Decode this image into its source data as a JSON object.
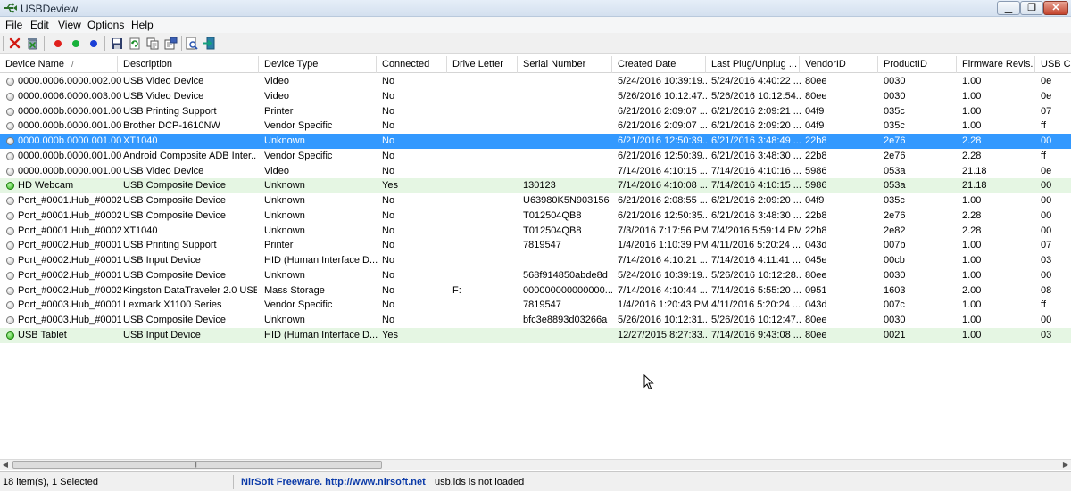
{
  "window": {
    "title": "USBDeview"
  },
  "menu": [
    "File",
    "Edit",
    "View",
    "Options",
    "Help"
  ],
  "toolbar": {
    "icons": [
      "disconnect-icon",
      "uninstall-icon",
      "red-dot-icon",
      "green-dot-icon",
      "blue-dot-icon",
      "save-icon",
      "refresh-icon",
      "copy-icon",
      "properties-icon",
      "report-icon",
      "exit-icon"
    ],
    "colors": {
      "red": "#e0201c",
      "green": "#17b13a",
      "blue": "#1b3fd6"
    }
  },
  "columns": [
    "Device Name",
    "Description",
    "Device Type",
    "Connected",
    "Drive Letter",
    "Serial Number",
    "Created Date",
    "Last Plug/Unplug ...",
    "VendorID",
    "ProductID",
    "Firmware Revis...",
    "USB Cla"
  ],
  "sort_indicator": "/",
  "rows": [
    {
      "connected_state": "off",
      "highlight": "none",
      "cells": [
        "0000.0006.0000.002.00...",
        "USB Video Device",
        "Video",
        "No",
        "",
        "",
        "5/24/2016 10:39:19...",
        "5/24/2016 4:40:22 ...",
        "80ee",
        "0030",
        "1.00",
        "0e"
      ]
    },
    {
      "connected_state": "off",
      "highlight": "none",
      "cells": [
        "0000.0006.0000.003.00...",
        "USB Video Device",
        "Video",
        "No",
        "",
        "",
        "5/26/2016 10:12:47...",
        "5/26/2016 10:12:54...",
        "80ee",
        "0030",
        "1.00",
        "0e"
      ]
    },
    {
      "connected_state": "off",
      "highlight": "none",
      "cells": [
        "0000.000b.0000.001.00...",
        "USB Printing Support",
        "Printer",
        "No",
        "",
        "",
        "6/21/2016 2:09:07 ...",
        "6/21/2016 2:09:21 ...",
        "04f9",
        "035c",
        "1.00",
        "07"
      ]
    },
    {
      "connected_state": "off",
      "highlight": "none",
      "cells": [
        "0000.000b.0000.001.00...",
        "Brother DCP-1610NW",
        "Vendor Specific",
        "No",
        "",
        "",
        "6/21/2016 2:09:07 ...",
        "6/21/2016 2:09:20 ...",
        "04f9",
        "035c",
        "1.00",
        "ff"
      ]
    },
    {
      "connected_state": "off",
      "highlight": "selected",
      "cells": [
        "0000.000b.0000.001.00...",
        "XT1040",
        "Unknown",
        "No",
        "",
        "",
        "6/21/2016 12:50:39...",
        "6/21/2016 3:48:49 ...",
        "22b8",
        "2e76",
        "2.28",
        "00"
      ]
    },
    {
      "connected_state": "off",
      "highlight": "none",
      "cells": [
        "0000.000b.0000.001.00...",
        "Android Composite ADB Inter...",
        "Vendor Specific",
        "No",
        "",
        "",
        "6/21/2016 12:50:39...",
        "6/21/2016 3:48:30 ...",
        "22b8",
        "2e76",
        "2.28",
        "ff"
      ]
    },
    {
      "connected_state": "off",
      "highlight": "none",
      "cells": [
        "0000.000b.0000.001.00...",
        "USB Video Device",
        "Video",
        "No",
        "",
        "",
        "7/14/2016 4:10:15 ...",
        "7/14/2016 4:10:16 ...",
        "5986",
        "053a",
        "21.18",
        "0e"
      ]
    },
    {
      "connected_state": "on",
      "highlight": "green",
      "cells": [
        "HD Webcam",
        "USB Composite Device",
        "Unknown",
        "Yes",
        "",
        "130123",
        "7/14/2016 4:10:08 ...",
        "7/14/2016 4:10:15 ...",
        "5986",
        "053a",
        "21.18",
        "00"
      ]
    },
    {
      "connected_state": "off",
      "highlight": "none",
      "cells": [
        "Port_#0001.Hub_#0002",
        "USB Composite Device",
        "Unknown",
        "No",
        "",
        "U63980K5N903156",
        "6/21/2016 2:08:55 ...",
        "6/21/2016 2:09:20 ...",
        "04f9",
        "035c",
        "1.00",
        "00"
      ]
    },
    {
      "connected_state": "off",
      "highlight": "none",
      "cells": [
        "Port_#0001.Hub_#0002",
        "USB Composite Device",
        "Unknown",
        "No",
        "",
        "T012504QB8",
        "6/21/2016 12:50:35...",
        "6/21/2016 3:48:30 ...",
        "22b8",
        "2e76",
        "2.28",
        "00"
      ]
    },
    {
      "connected_state": "off",
      "highlight": "none",
      "cells": [
        "Port_#0001.Hub_#0002",
        "XT1040",
        "Unknown",
        "No",
        "",
        "T012504QB8",
        "7/3/2016 7:17:56 PM",
        "7/4/2016 5:59:14 PM",
        "22b8",
        "2e82",
        "2.28",
        "00"
      ]
    },
    {
      "connected_state": "off",
      "highlight": "none",
      "cells": [
        "Port_#0002.Hub_#0001",
        "USB Printing Support",
        "Printer",
        "No",
        "",
        "7819547",
        "1/4/2016 1:10:39 PM",
        "4/11/2016 5:20:24 ...",
        "043d",
        "007b",
        "1.00",
        "07"
      ]
    },
    {
      "connected_state": "off",
      "highlight": "none",
      "cells": [
        "Port_#0002.Hub_#0001",
        "USB Input Device",
        "HID (Human Interface D...",
        "No",
        "",
        "",
        "7/14/2016 4:10:21 ...",
        "7/14/2016 4:11:41 ...",
        "045e",
        "00cb",
        "1.00",
        "03"
      ]
    },
    {
      "connected_state": "off",
      "highlight": "none",
      "cells": [
        "Port_#0002.Hub_#0001",
        "USB Composite Device",
        "Unknown",
        "No",
        "",
        "568f914850abde8d",
        "5/24/2016 10:39:19...",
        "5/26/2016 10:12:28...",
        "80ee",
        "0030",
        "1.00",
        "00"
      ]
    },
    {
      "connected_state": "off",
      "highlight": "none",
      "cells": [
        "Port_#0002.Hub_#0002",
        "Kingston DataTraveler 2.0 USB...",
        "Mass Storage",
        "No",
        "F:",
        "000000000000000...",
        "7/14/2016 4:10:44 ...",
        "7/14/2016 5:55:20 ...",
        "0951",
        "1603",
        "2.00",
        "08"
      ]
    },
    {
      "connected_state": "off",
      "highlight": "none",
      "cells": [
        "Port_#0003.Hub_#0001",
        "Lexmark X1100 Series",
        "Vendor Specific",
        "No",
        "",
        "7819547",
        "1/4/2016 1:20:43 PM",
        "4/11/2016 5:20:24 ...",
        "043d",
        "007c",
        "1.00",
        "ff"
      ]
    },
    {
      "connected_state": "off",
      "highlight": "none",
      "cells": [
        "Port_#0003.Hub_#0001",
        "USB Composite Device",
        "Unknown",
        "No",
        "",
        "bfc3e8893d03266a",
        "5/26/2016 10:12:31...",
        "5/26/2016 10:12:47...",
        "80ee",
        "0030",
        "1.00",
        "00"
      ]
    },
    {
      "connected_state": "on",
      "highlight": "green",
      "cells": [
        "USB Tablet",
        "USB Input Device",
        "HID (Human Interface D...",
        "Yes",
        "",
        "",
        "12/27/2015 8:27:33...",
        "7/14/2016 9:43:08 ...",
        "80ee",
        "0021",
        "1.00",
        "03"
      ]
    }
  ],
  "status": {
    "count": "18 item(s), 1 Selected",
    "brand": "NirSoft Freeware.  http://www.nirsoft.net",
    "usbids": "usb.ids is not loaded"
  }
}
